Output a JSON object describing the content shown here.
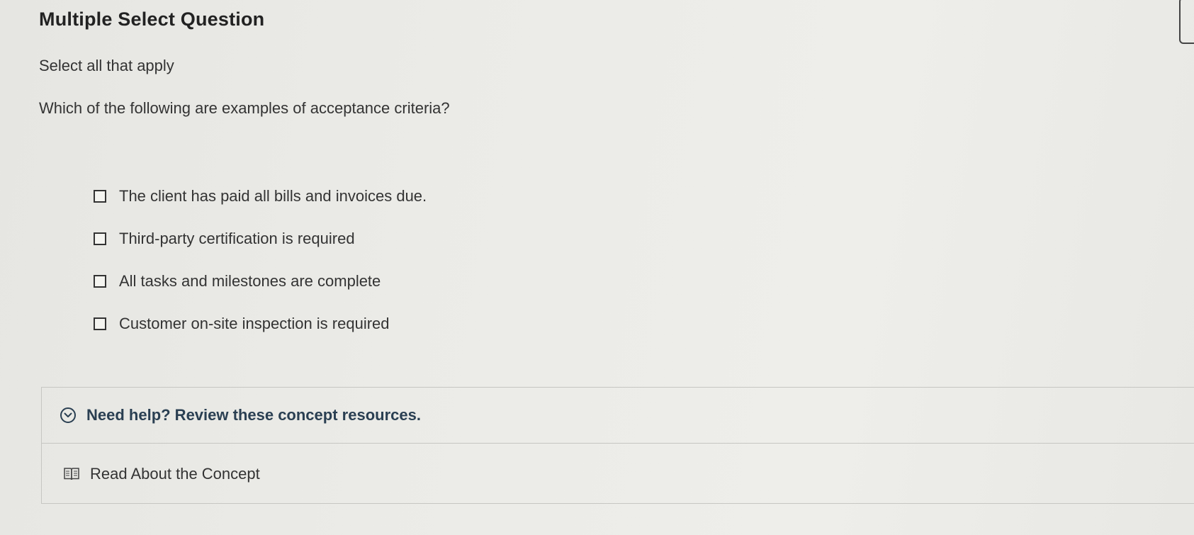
{
  "question": {
    "heading": "Multiple Select Question",
    "instruction": "Select all that apply",
    "prompt": "Which of the following are examples of acceptance criteria?",
    "choices": [
      {
        "label": "The client has paid all bills and invoices due.",
        "checked": false
      },
      {
        "label": "Third-party certification is required",
        "checked": false
      },
      {
        "label": "All tasks and milestones are complete",
        "checked": false
      },
      {
        "label": "Customer on-site inspection is required",
        "checked": false
      }
    ]
  },
  "help": {
    "title": "Need help? Review these concept resources.",
    "icon": "chevron-down-circle-icon",
    "resources": [
      {
        "label": "Read About the Concept",
        "icon": "book-icon"
      }
    ]
  },
  "colors": {
    "accent": "#2a3f52",
    "text": "#333333",
    "border": "#c6c6c2"
  }
}
